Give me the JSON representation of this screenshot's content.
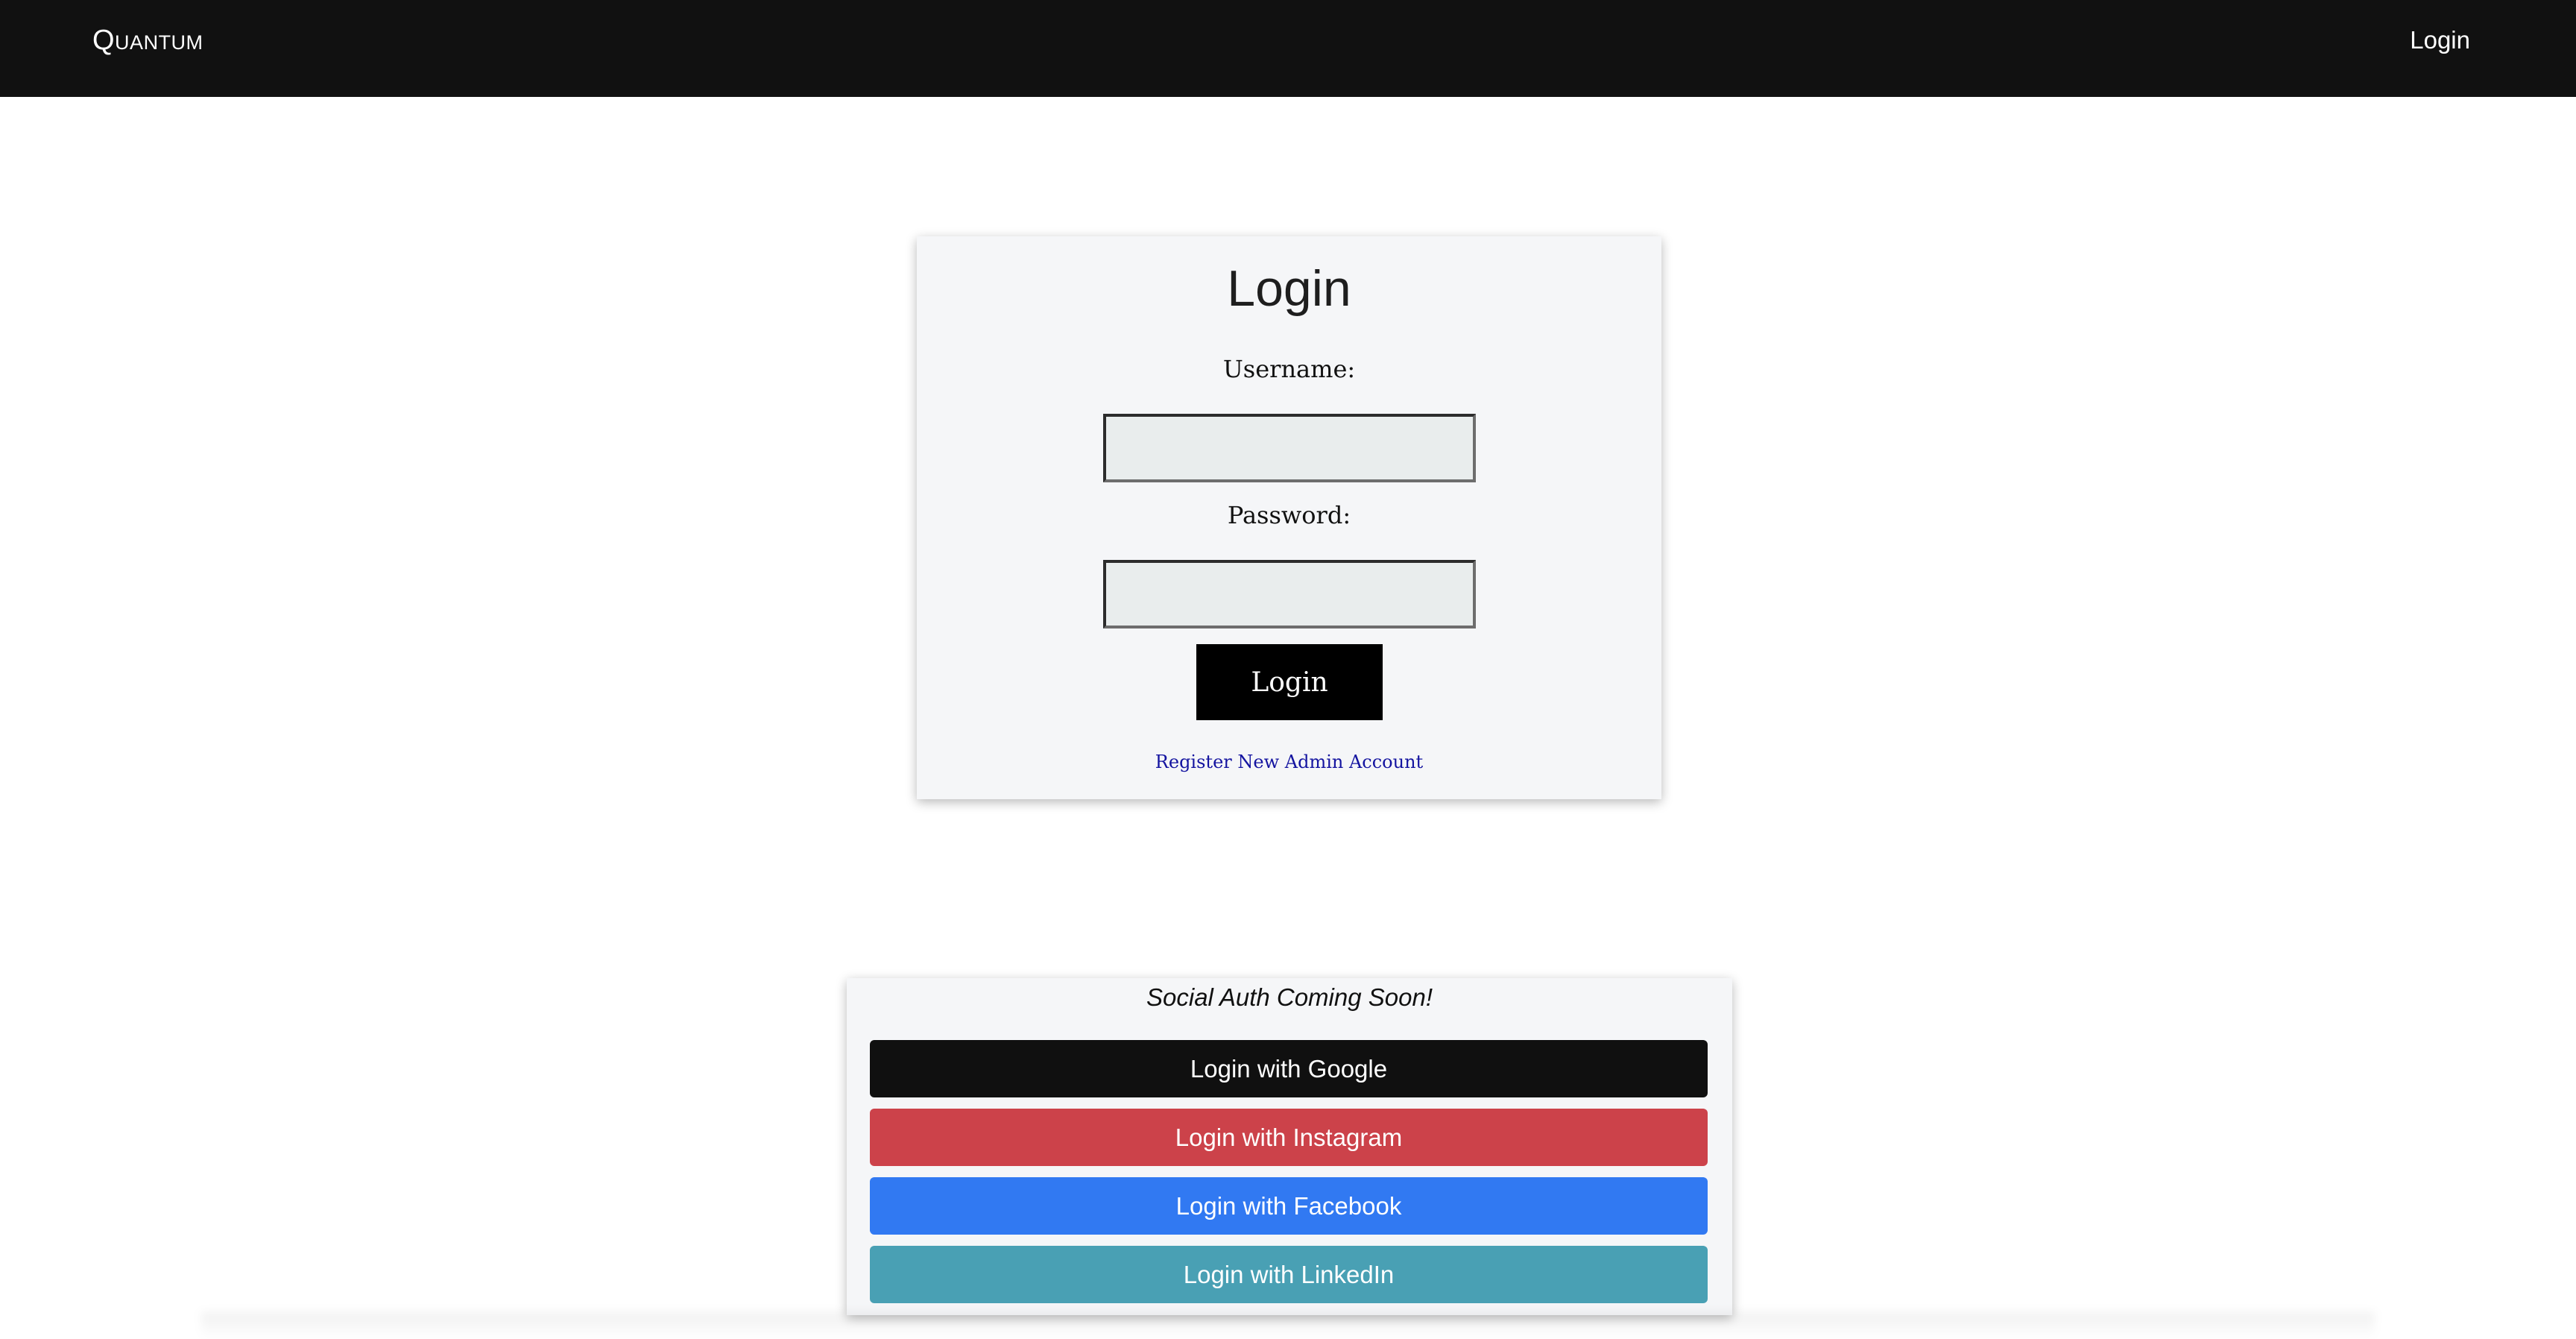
{
  "navbar": {
    "brand": "Quantum",
    "login_link": "Login"
  },
  "login_form": {
    "title": "Login",
    "username_label": "Username:",
    "username_value": "",
    "password_label": "Password:",
    "password_value": "",
    "submit_label": "Login",
    "register_link": "Register New Admin Account"
  },
  "social_auth": {
    "title": "Social Auth Coming Soon!",
    "buttons": [
      {
        "label": "Login with Google",
        "color": "#101010"
      },
      {
        "label": "Login with Instagram",
        "color": "#cc424a"
      },
      {
        "label": "Login with Facebook",
        "color": "#3179f2"
      },
      {
        "label": "Login with LinkedIn",
        "color": "#49a0b4"
      }
    ]
  },
  "colors": {
    "navbar_bg": "#111111",
    "card_bg": "#f5f6f8",
    "input_bg": "#e9eded",
    "link": "#1414a0"
  }
}
